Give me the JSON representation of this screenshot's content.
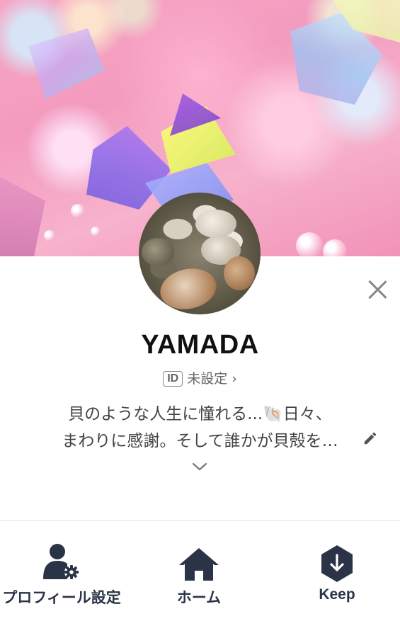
{
  "profile": {
    "name": "YAMADA",
    "id_badge": "ID",
    "id_value": "未設定",
    "id_chevron": "›",
    "status_line1": "貝のような人生に憧れる...🐚日々、",
    "status_line2": "まわりに感謝。そして誰かが貝殻を…"
  },
  "icons": {
    "close": "close-icon",
    "edit": "pencil-icon",
    "expand": "chevron-down-icon",
    "profile_settings": "profile-settings-icon",
    "home": "home-icon",
    "keep": "keep-icon"
  },
  "bottom_nav": {
    "profile_settings_label": "プロフィール設定",
    "home_label": "ホーム",
    "keep_label": "Keep"
  },
  "colors": {
    "nav_icon": "#2b3447",
    "text_secondary": "#666666"
  }
}
